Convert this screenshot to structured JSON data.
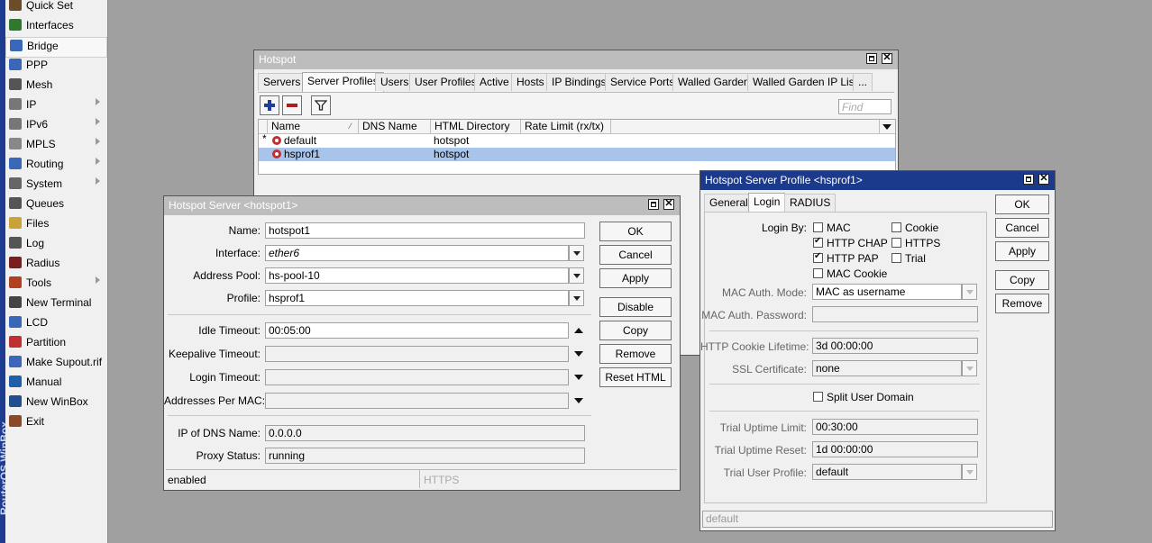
{
  "sidebar": {
    "brand_text": "RouterOS WinBox",
    "items": [
      {
        "label": "Quick Set",
        "icon": "wand-icon",
        "submenu": false
      },
      {
        "label": "Interfaces",
        "icon": "interfaces-icon",
        "submenu": false
      },
      {
        "label": "Bridge",
        "icon": "bridge-icon",
        "submenu": false
      },
      {
        "label": "PPP",
        "icon": "ppp-icon",
        "submenu": false
      },
      {
        "label": "Mesh",
        "icon": "mesh-icon",
        "submenu": false
      },
      {
        "label": "IP",
        "icon": "ip-icon",
        "submenu": true
      },
      {
        "label": "IPv6",
        "icon": "ipv6-icon",
        "submenu": true
      },
      {
        "label": "MPLS",
        "icon": "mpls-icon",
        "submenu": true
      },
      {
        "label": "Routing",
        "icon": "routing-icon",
        "submenu": true
      },
      {
        "label": "System",
        "icon": "gear-icon",
        "submenu": true
      },
      {
        "label": "Queues",
        "icon": "queues-icon",
        "submenu": false
      },
      {
        "label": "Files",
        "icon": "folder-icon",
        "submenu": false
      },
      {
        "label": "Log",
        "icon": "log-icon",
        "submenu": false
      },
      {
        "label": "Radius",
        "icon": "radius-icon",
        "submenu": false
      },
      {
        "label": "Tools",
        "icon": "tools-icon",
        "submenu": true
      },
      {
        "label": "New Terminal",
        "icon": "terminal-icon",
        "submenu": false
      },
      {
        "label": "LCD",
        "icon": "lcd-icon",
        "submenu": false
      },
      {
        "label": "Partition",
        "icon": "partition-icon",
        "submenu": false
      },
      {
        "label": "Make Supout.rif",
        "icon": "supout-icon",
        "submenu": false
      },
      {
        "label": "Manual",
        "icon": "manual-icon",
        "submenu": false
      },
      {
        "label": "New WinBox",
        "icon": "winbox-icon",
        "submenu": false
      },
      {
        "label": "Exit",
        "icon": "exit-icon",
        "submenu": false
      }
    ]
  },
  "hotspot": {
    "title": "Hotspot",
    "tabs": [
      "Servers",
      "Server Profiles",
      "Users",
      "User Profiles",
      "Active",
      "Hosts",
      "IP Bindings",
      "Service Ports",
      "Walled Garden",
      "Walled Garden IP List",
      "..."
    ],
    "find_placeholder": "Find",
    "columns": [
      "Name",
      "DNS Name",
      "HTML Directory",
      "Rate Limit (rx/tx)"
    ],
    "rows": [
      {
        "flag": "*",
        "name": "default",
        "dns": "",
        "html": "hotspot",
        "rate": ""
      },
      {
        "flag": "",
        "name": "hsprof1",
        "dns": "",
        "html": "hotspot",
        "rate": ""
      }
    ]
  },
  "server": {
    "title": "Hotspot Server <hotspot1>",
    "labels": {
      "name": "Name:",
      "interface": "Interface:",
      "pool": "Address Pool:",
      "profile": "Profile:",
      "idle": "Idle Timeout:",
      "keepalive": "Keepalive Timeout:",
      "login": "Login Timeout:",
      "per_mac": "Addresses Per MAC:",
      "dns_ip": "IP of DNS Name:",
      "proxy": "Proxy Status:"
    },
    "values": {
      "name": "hotspot1",
      "interface": "ether6",
      "pool": "hs-pool-10",
      "profile": "hsprof1",
      "idle": "00:05:00",
      "keepalive": "",
      "login": "",
      "per_mac": "",
      "dns_ip": "0.0.0.0",
      "proxy": "running"
    },
    "buttons": [
      "OK",
      "Cancel",
      "Apply",
      "Disable",
      "Copy",
      "Remove",
      "Reset HTML"
    ],
    "status_left": "enabled",
    "status_right": "HTTPS"
  },
  "profile": {
    "title": "Hotspot Server Profile <hsprof1>",
    "tabs": [
      "General",
      "Login",
      "RADIUS"
    ],
    "login_by_label": "Login By:",
    "checkboxes": [
      {
        "label": "MAC",
        "checked": false
      },
      {
        "label": "Cookie",
        "checked": false
      },
      {
        "label": "HTTP CHAP",
        "checked": true
      },
      {
        "label": "HTTPS",
        "checked": false
      },
      {
        "label": "HTTP PAP",
        "checked": true
      },
      {
        "label": "Trial",
        "checked": false
      },
      {
        "label": "MAC Cookie",
        "checked": false
      }
    ],
    "labels": {
      "mac_mode": "MAC Auth. Mode:",
      "mac_pass": "MAC Auth. Password:",
      "cookie": "HTTP Cookie Lifetime:",
      "ssl": "SSL Certificate:",
      "split": "Split User Domain",
      "trial_limit": "Trial Uptime Limit:",
      "trial_reset": "Trial Uptime Reset:",
      "trial_profile": "Trial User Profile:"
    },
    "values": {
      "mac_mode": "MAC as username",
      "mac_pass": "",
      "cookie": "3d 00:00:00",
      "ssl": "none",
      "trial_limit": "00:30:00",
      "trial_reset": "1d 00:00:00",
      "trial_profile": "default"
    },
    "buttons": [
      "OK",
      "Cancel",
      "Apply",
      "Copy",
      "Remove"
    ],
    "status": "default"
  },
  "colors": {
    "titlebar_active": "#1c3a8c",
    "titlebar_inactive": "#bdbdbd",
    "row_selected": "#a9c4ea",
    "desktop": "#a0a0a0"
  }
}
